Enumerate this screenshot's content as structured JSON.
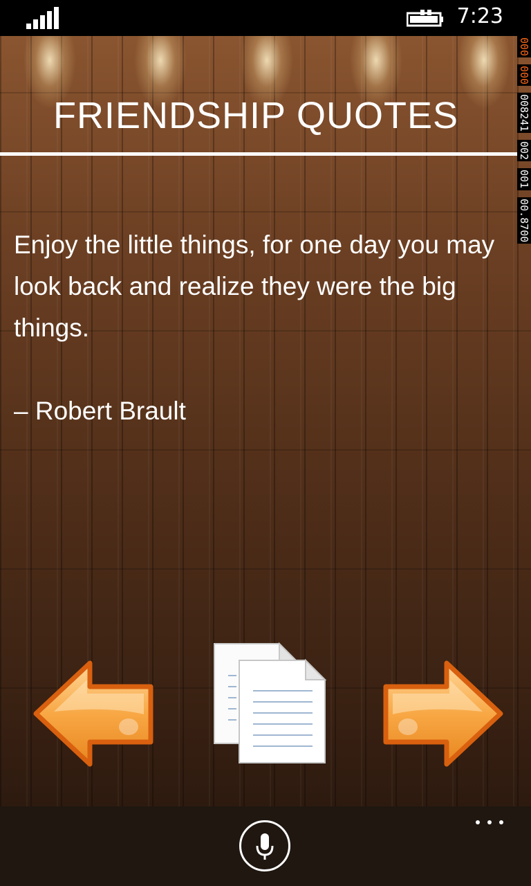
{
  "status_bar": {
    "time": "7:23",
    "signal_icon": "signal-bars-icon",
    "battery_icon": "battery-charging-icon"
  },
  "page": {
    "title": "FRIENDSHIP QUOTES",
    "quote_text": "Enjoy the little things, for one day you may look back and realize they were the big things.",
    "quote_author": "– Robert Brault"
  },
  "counters": [
    "000",
    "000",
    "008241",
    "002",
    "001",
    "00.8700"
  ],
  "actions": {
    "prev_icon": "left-arrow-icon",
    "copy_icon": "copy-documents-icon",
    "next_icon": "right-arrow-icon"
  },
  "app_bar": {
    "mic_icon": "microphone-icon",
    "more_icon": "more-dots-icon"
  },
  "colors": {
    "arrow_fill": "#f7a23a",
    "arrow_outline": "#d8600f",
    "counter_orange": "#ff6a1a",
    "app_bar_bg": "#1f1710"
  }
}
